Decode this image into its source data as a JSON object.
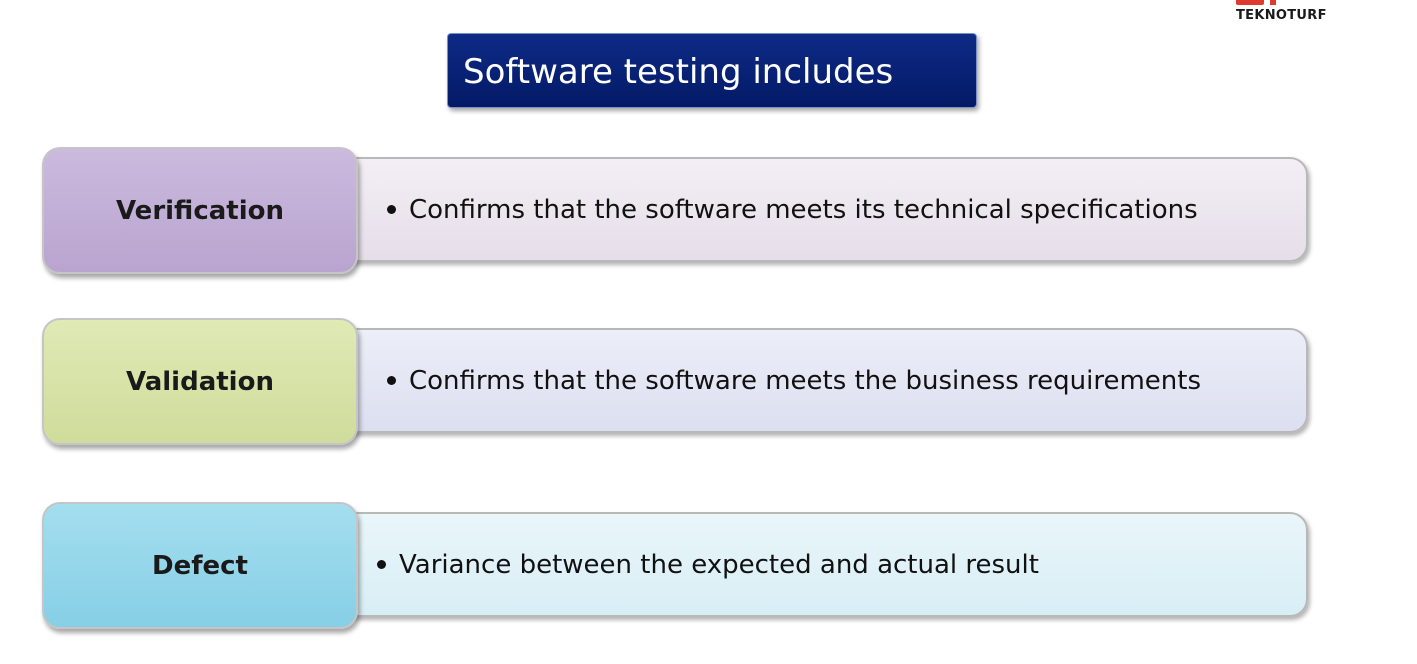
{
  "logo": {
    "text": "TEKNOTURF"
  },
  "title": "Software testing includes",
  "rows": [
    {
      "label": "Verification",
      "description": "Confirms that the software meets its technical specifications",
      "label_color": "#c0acd5",
      "body_color": "#ece5ef"
    },
    {
      "label": "Validation",
      "description": "Confirms that the software meets the business requirements",
      "label_color": "#d6e3a8",
      "body_color": "#e3e5f4"
    },
    {
      "label": "Defect",
      "description": "Variance between the expected and actual result",
      "label_color": "#93d7ec",
      "body_color": "#e0f2f8"
    }
  ]
}
